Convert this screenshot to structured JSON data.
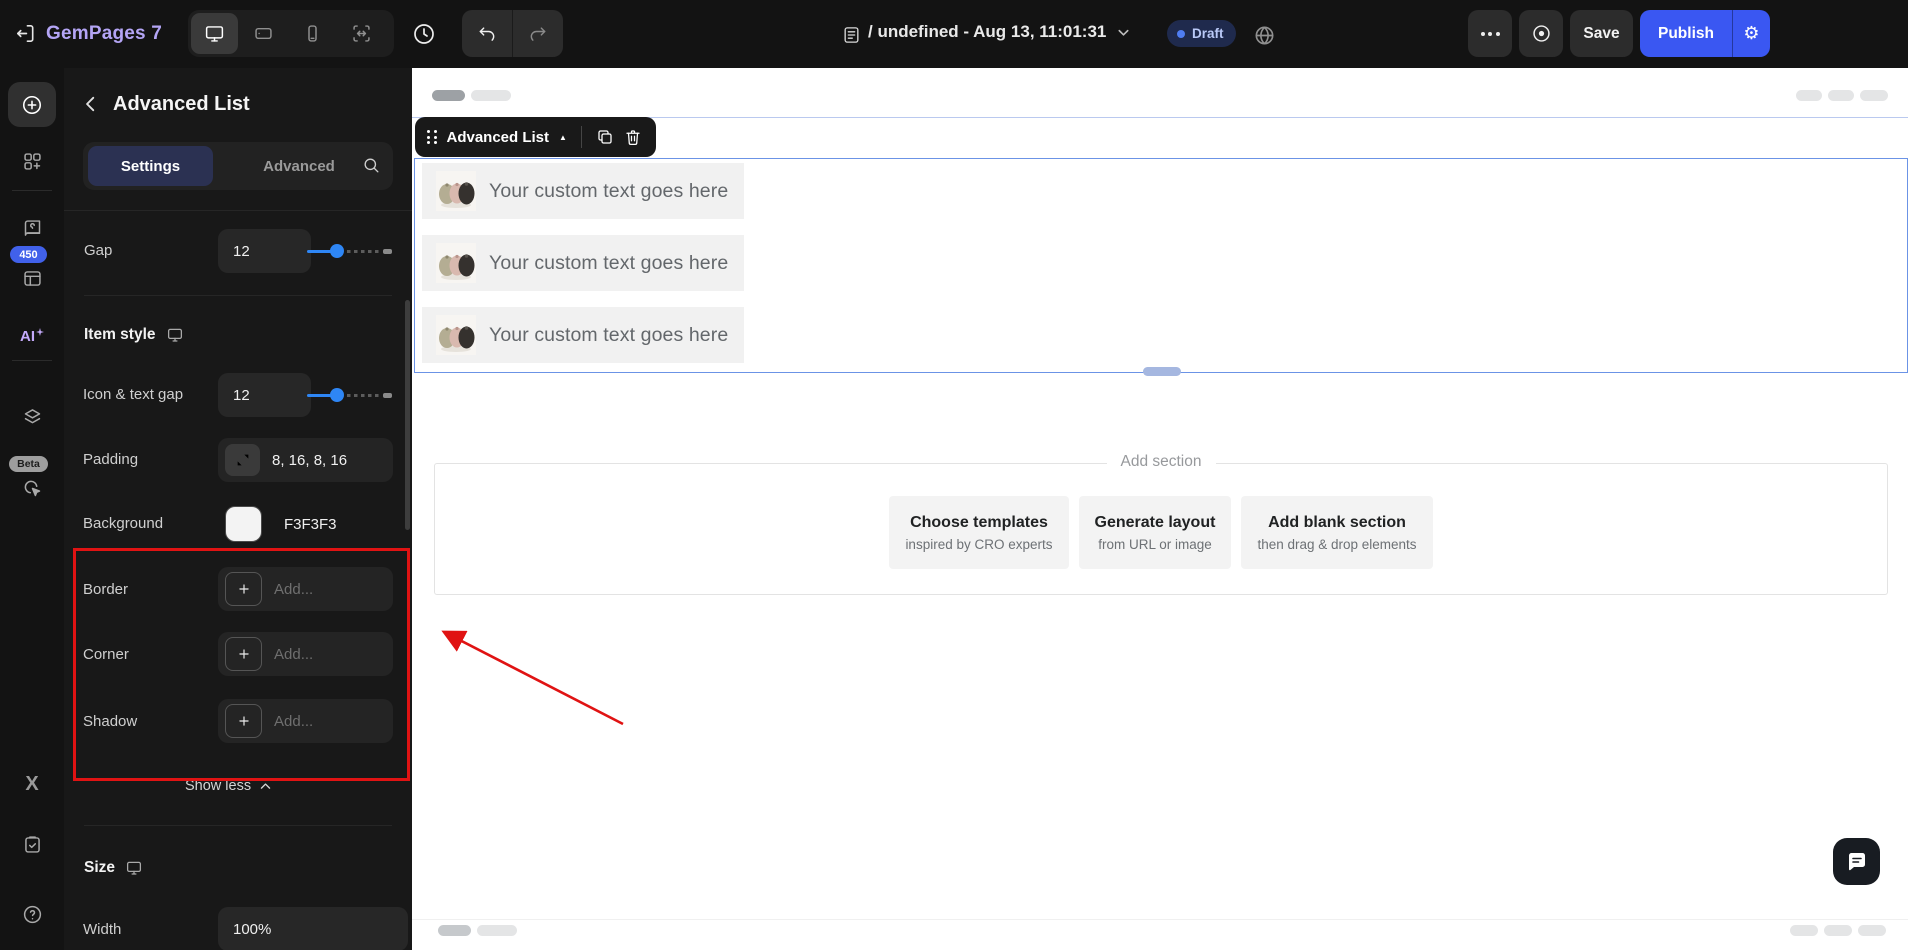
{
  "topbar": {
    "brand": "GemPages 7",
    "page_title": "/ undefined - Aug 13, 11:01:31",
    "status_badge": "Draft",
    "save": "Save",
    "publish": "Publish"
  },
  "sidebar": {
    "counter_badge": "450",
    "ai": "AI",
    "beta": "Beta",
    "x": "X"
  },
  "panel": {
    "title": "Advanced List",
    "tabs": {
      "settings": "Settings",
      "advanced": "Advanced"
    },
    "gap": {
      "label": "Gap",
      "value": "12"
    },
    "item_style": {
      "heading": "Item style"
    },
    "icon_text_gap": {
      "label": "Icon & text gap",
      "value": "12"
    },
    "padding": {
      "label": "Padding",
      "value": "8, 16, 8, 16"
    },
    "background": {
      "label": "Background",
      "value": "F3F3F3",
      "swatch_color": "#F3F3F3"
    },
    "border": {
      "label": "Border",
      "placeholder": "Add..."
    },
    "corner": {
      "label": "Corner",
      "placeholder": "Add..."
    },
    "shadow": {
      "label": "Shadow",
      "placeholder": "Add..."
    },
    "show_less": "Show less",
    "size": {
      "heading": "Size"
    },
    "width": {
      "label": "Width",
      "value": "100%"
    }
  },
  "canvas": {
    "toolbar_label": "Advanced List",
    "list_items": [
      "Your custom text goes here",
      "Your custom text goes here",
      "Your custom text goes here"
    ],
    "add_section": {
      "label": "Add section",
      "options": [
        {
          "title": "Choose templates",
          "subtitle": "inspired by CRO experts"
        },
        {
          "title": "Generate layout",
          "subtitle": "from URL or image"
        },
        {
          "title": "Add blank section",
          "subtitle": "then drag & drop elements"
        }
      ]
    }
  },
  "colors": {
    "publish_blue": "#3a57f2",
    "slider_blue": "#2e86f5",
    "selection_blue": "#6b93e6",
    "annotation_red": "#e01313",
    "draft_badge_bg": "#1f2a4d",
    "draft_badge_text": "#b9c9f7",
    "item_background": "#F3F3F3",
    "brand_purple": "#b4a5f5"
  },
  "icons": {
    "exit": "door-arrow-left",
    "desktop": "monitor",
    "tablet": "tablet",
    "mobile": "phone",
    "responsive": "arrows-horizontal",
    "history": "clock",
    "undo": "arrow-curve-left",
    "redo": "arrow-curve-right",
    "page": "document",
    "caret": "chevron-down",
    "translate": "globe",
    "more": "ellipsis",
    "preview": "circle-dot",
    "settings_gear": "gear",
    "add_element": "circle-plus",
    "sections": "grid-plus",
    "pages": "book",
    "theme": "box",
    "ai_spark": "sparkle",
    "layers": "layers",
    "interactions": "cursor-click",
    "tasks": "clipboard-check",
    "help": "question-circle",
    "search": "magnifier",
    "device_target": "monitor",
    "padding_edit": "expand-arrows",
    "add": "plus",
    "collapse": "chevron-up",
    "drag": "dots-grid",
    "element_caret": "triangle-up",
    "duplicate": "copy",
    "delete": "trash",
    "chat": "chat-bubble"
  }
}
